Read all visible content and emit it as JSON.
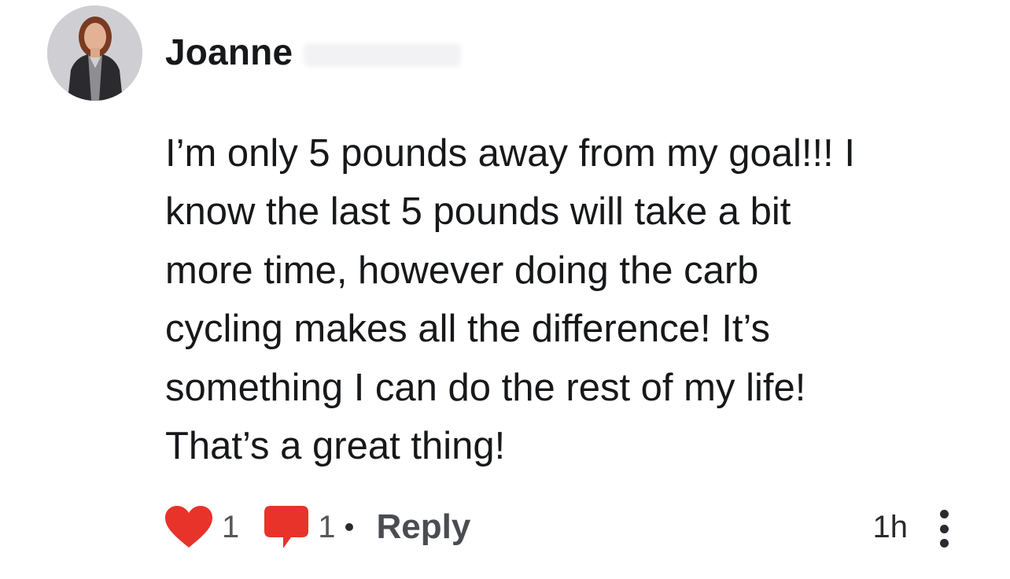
{
  "comment": {
    "author": "Joanne",
    "body": "I’m only 5 pounds away from my goal!!! I\nknow the last 5 pounds will take a bit\nmore time, however doing the carb\ncycling makes all the difference! It’s\nsomething I can do the rest of my life!\nThat’s a great thing!",
    "likes": "1",
    "replies": "1",
    "reply_label": "Reply",
    "timestamp": "1h"
  },
  "icons": {
    "like": "heart-icon",
    "comment": "speech-bubble-icon",
    "more": "vertical-ellipsis-icon"
  },
  "colors": {
    "accent": "#e8332a",
    "text": "#17181a",
    "muted": "#55575c"
  }
}
